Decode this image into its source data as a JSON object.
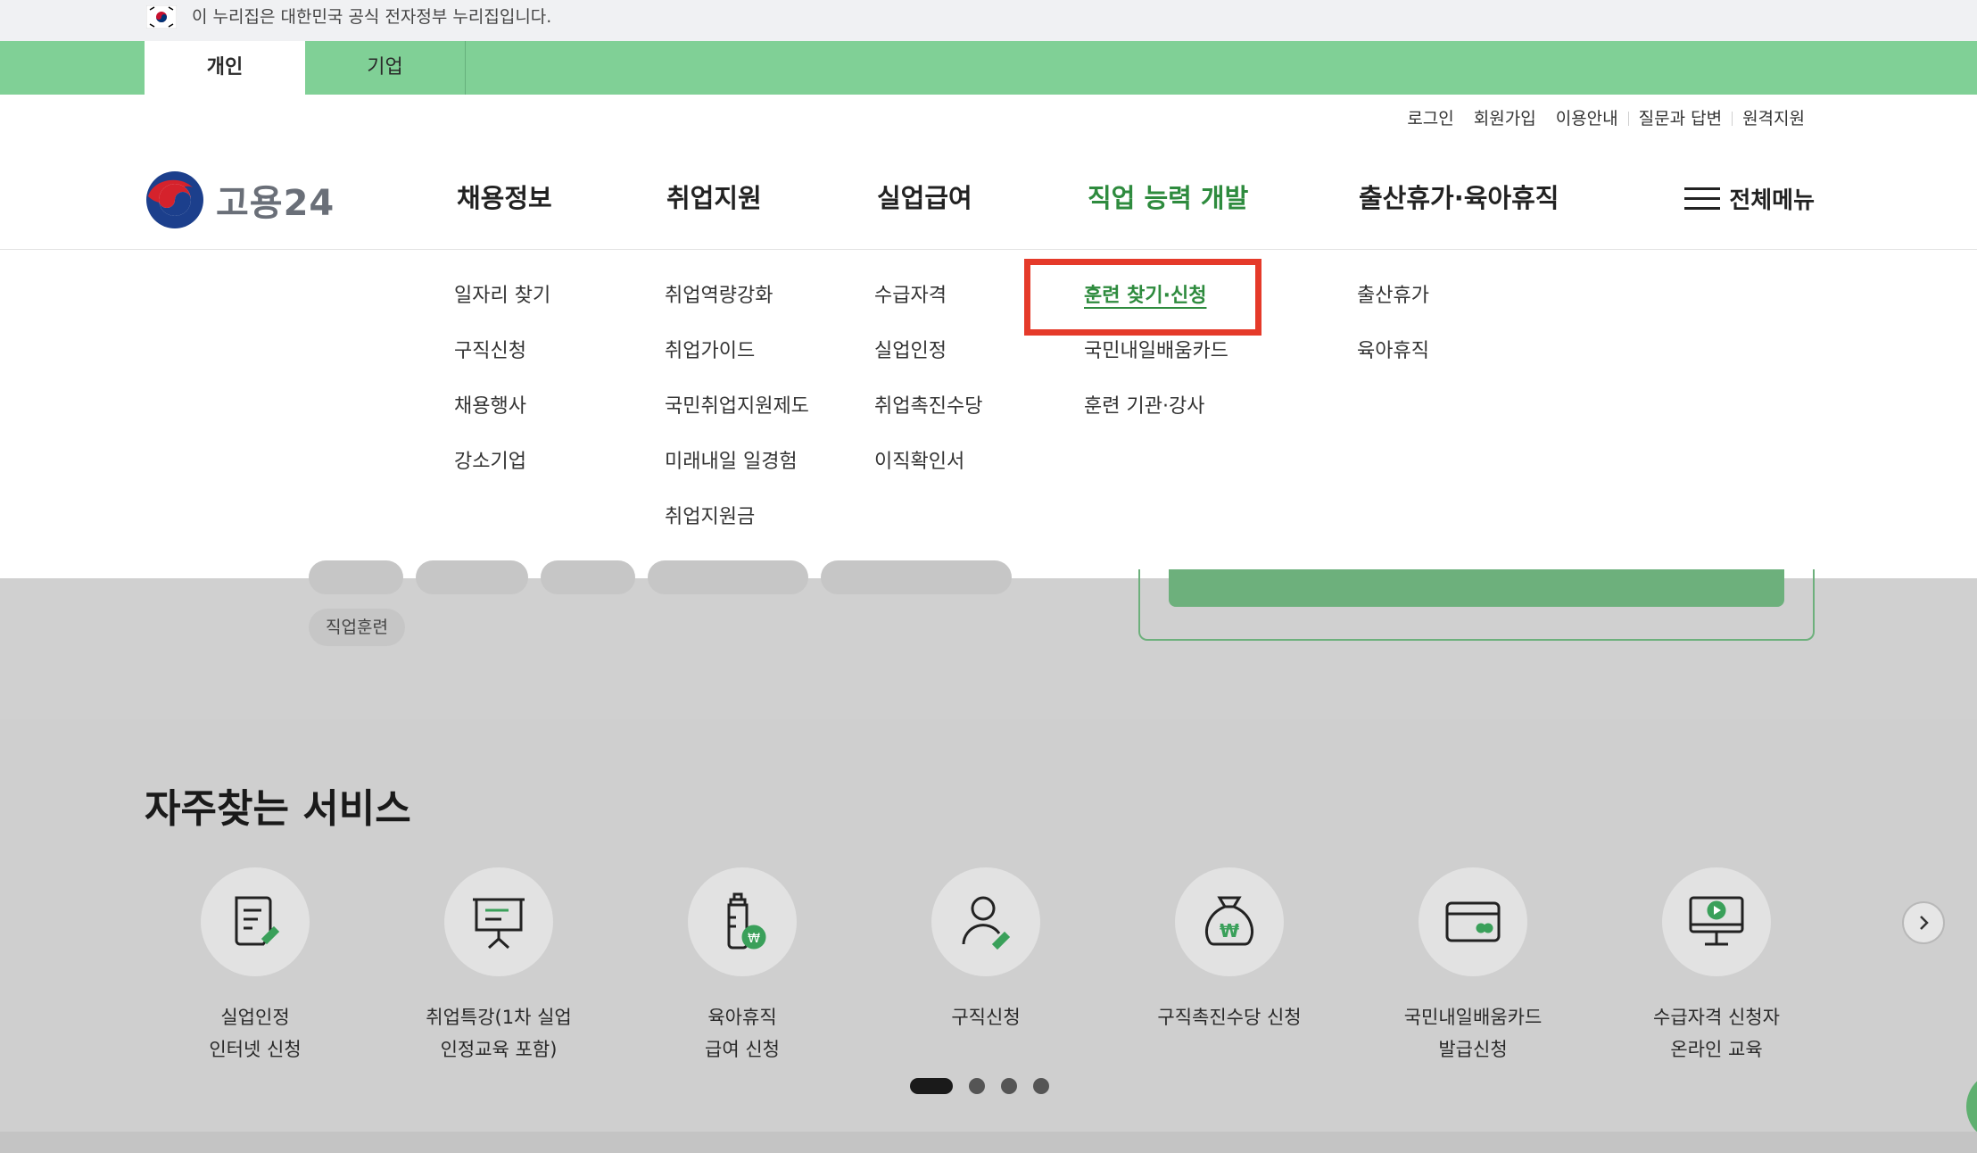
{
  "gov_banner": {
    "text": "이 누리집은 대한민국 공식 전자정부 누리집입니다."
  },
  "tabs": [
    {
      "label": "개인"
    },
    {
      "label": "기업"
    }
  ],
  "util_links": [
    "로그인",
    "회원가입",
    "이용안내",
    "질문과 답변",
    "원격지원"
  ],
  "logo": {
    "text": "고용24"
  },
  "gnb": [
    {
      "label": "채용정보"
    },
    {
      "label": "취업지원"
    },
    {
      "label": "실업급여"
    },
    {
      "label": "직업 능력 개발"
    },
    {
      "label": "출산휴가·육아휴직"
    }
  ],
  "allmenu": {
    "label": "전체메뉴"
  },
  "dropdown": {
    "col1": [
      "일자리 찾기",
      "구직신청",
      "채용행사",
      "강소기업"
    ],
    "col2": [
      "취업역량강화",
      "취업가이드",
      "국민취업지원제도",
      "미래내일 일경험",
      "취업지원금"
    ],
    "col3": [
      "수급자격",
      "실업인정",
      "취업촉진수당",
      "이직확인서"
    ],
    "col4": [
      "훈련 찾기·신청",
      "국민내일배움카드",
      "훈련 기관·강사"
    ],
    "col5": [
      "출산휴가",
      "육아휴직"
    ]
  },
  "behind": {
    "pill_label": "직업훈련"
  },
  "services": {
    "title": "자주찾는 서비스",
    "items": [
      {
        "label": "실업인정\n인터넷 신청",
        "icon": "document-pen-icon"
      },
      {
        "label": "취업특강(1차 실업\n인정교육 포함)",
        "icon": "presentation-board-icon"
      },
      {
        "label": "육아휴직\n급여 신청",
        "icon": "baby-bottle-won-icon"
      },
      {
        "label": "구직신청",
        "icon": "person-pen-icon"
      },
      {
        "label": "구직촉진수당 신청",
        "icon": "money-bag-won-icon"
      },
      {
        "label": "국민내일배움카드\n발급신청",
        "icon": "card-icon"
      },
      {
        "label": "수급자격 신청자\n온라인 교육",
        "icon": "monitor-play-icon"
      }
    ]
  },
  "colors": {
    "accent_green": "#2e8b3e",
    "tab_green": "#80d096",
    "highlight_red": "#e53a2a"
  }
}
